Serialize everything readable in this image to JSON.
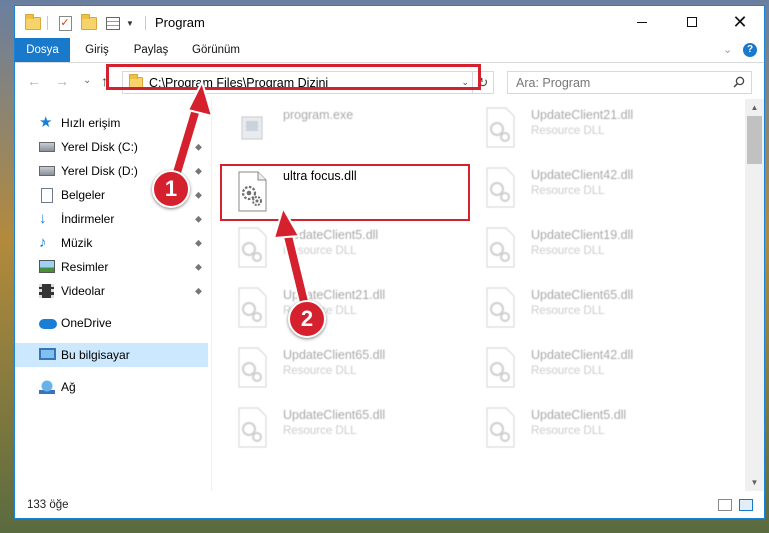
{
  "window": {
    "title": "Program",
    "minimize": "—",
    "maximize": "☐",
    "close": "✕"
  },
  "ribbon": {
    "tabs": [
      {
        "label": "Dosya",
        "active": true
      },
      {
        "label": "Giriş"
      },
      {
        "label": "Paylaş"
      },
      {
        "label": "Görünüm"
      }
    ],
    "expand": "⌄",
    "help": "?"
  },
  "nav": {
    "back": "←",
    "forward": "→",
    "recent": "⌄",
    "up": "↑",
    "address": "C:\\Program Files\\Program Dizini",
    "address_dropdown": "⌄",
    "refresh": "↻",
    "search_placeholder": "Ara: Program"
  },
  "sidebar": {
    "items": [
      {
        "label": "Hızlı erişim",
        "icon": "star-icon"
      },
      {
        "label": "Yerel Disk (C:)",
        "icon": "disk-icon",
        "pinned": true
      },
      {
        "label": "Yerel Disk (D:)",
        "icon": "disk-icon",
        "pinned": true
      },
      {
        "label": "Belgeler",
        "icon": "documents-icon",
        "pinned": true
      },
      {
        "label": "İndirmeler",
        "icon": "downloads-icon",
        "pinned": true
      },
      {
        "label": "Müzik",
        "icon": "music-icon",
        "pinned": true
      },
      {
        "label": "Resimler",
        "icon": "pictures-icon",
        "pinned": true
      },
      {
        "label": "Videolar",
        "icon": "videos-icon",
        "pinned": true
      },
      {
        "label": "OneDrive",
        "icon": "onedrive-icon"
      },
      {
        "label": "Bu bilgisayar",
        "icon": "this-pc-icon",
        "selected": true
      },
      {
        "label": "Ağ",
        "icon": "network-icon"
      }
    ],
    "pin_glyph": "📌"
  },
  "files": [
    {
      "name": "program.exe",
      "type": "",
      "icon": "exe-icon"
    },
    {
      "name": "UpdateClient21.dll",
      "type": "Resource DLL",
      "icon": "dll-icon"
    },
    {
      "name": "ultra focus.dll",
      "type": "",
      "icon": "dll-gear-icon",
      "highlighted": true
    },
    {
      "name": "UpdateClient42.dll",
      "type": "Resource DLL",
      "icon": "dll-icon"
    },
    {
      "name": "UpdateClient5.dll",
      "type": "Resource DLL",
      "icon": "dll-icon"
    },
    {
      "name": "UpdateClient19.dll",
      "type": "Resource DLL",
      "icon": "dll-icon"
    },
    {
      "name": "UpdateClient21.dll",
      "type": "Resource DLL",
      "icon": "dll-icon"
    },
    {
      "name": "UpdateClient65.dll",
      "type": "Resource DLL",
      "icon": "dll-icon"
    },
    {
      "name": "UpdateClient65.dll",
      "type": "Resource DLL",
      "icon": "dll-icon"
    },
    {
      "name": "UpdateClient42.dll",
      "type": "Resource DLL",
      "icon": "dll-icon"
    },
    {
      "name": "UpdateClient65.dll",
      "type": "Resource DLL",
      "icon": "dll-icon"
    },
    {
      "name": "UpdateClient5.dll",
      "type": "Resource DLL",
      "icon": "dll-icon"
    }
  ],
  "status": {
    "count": "133 öğe"
  },
  "callouts": {
    "one": "1",
    "two": "2",
    "color": "#d5202e"
  },
  "colors": {
    "accent": "#1979ca",
    "selected": "#cce8ff",
    "highlight": "#d5202e"
  }
}
